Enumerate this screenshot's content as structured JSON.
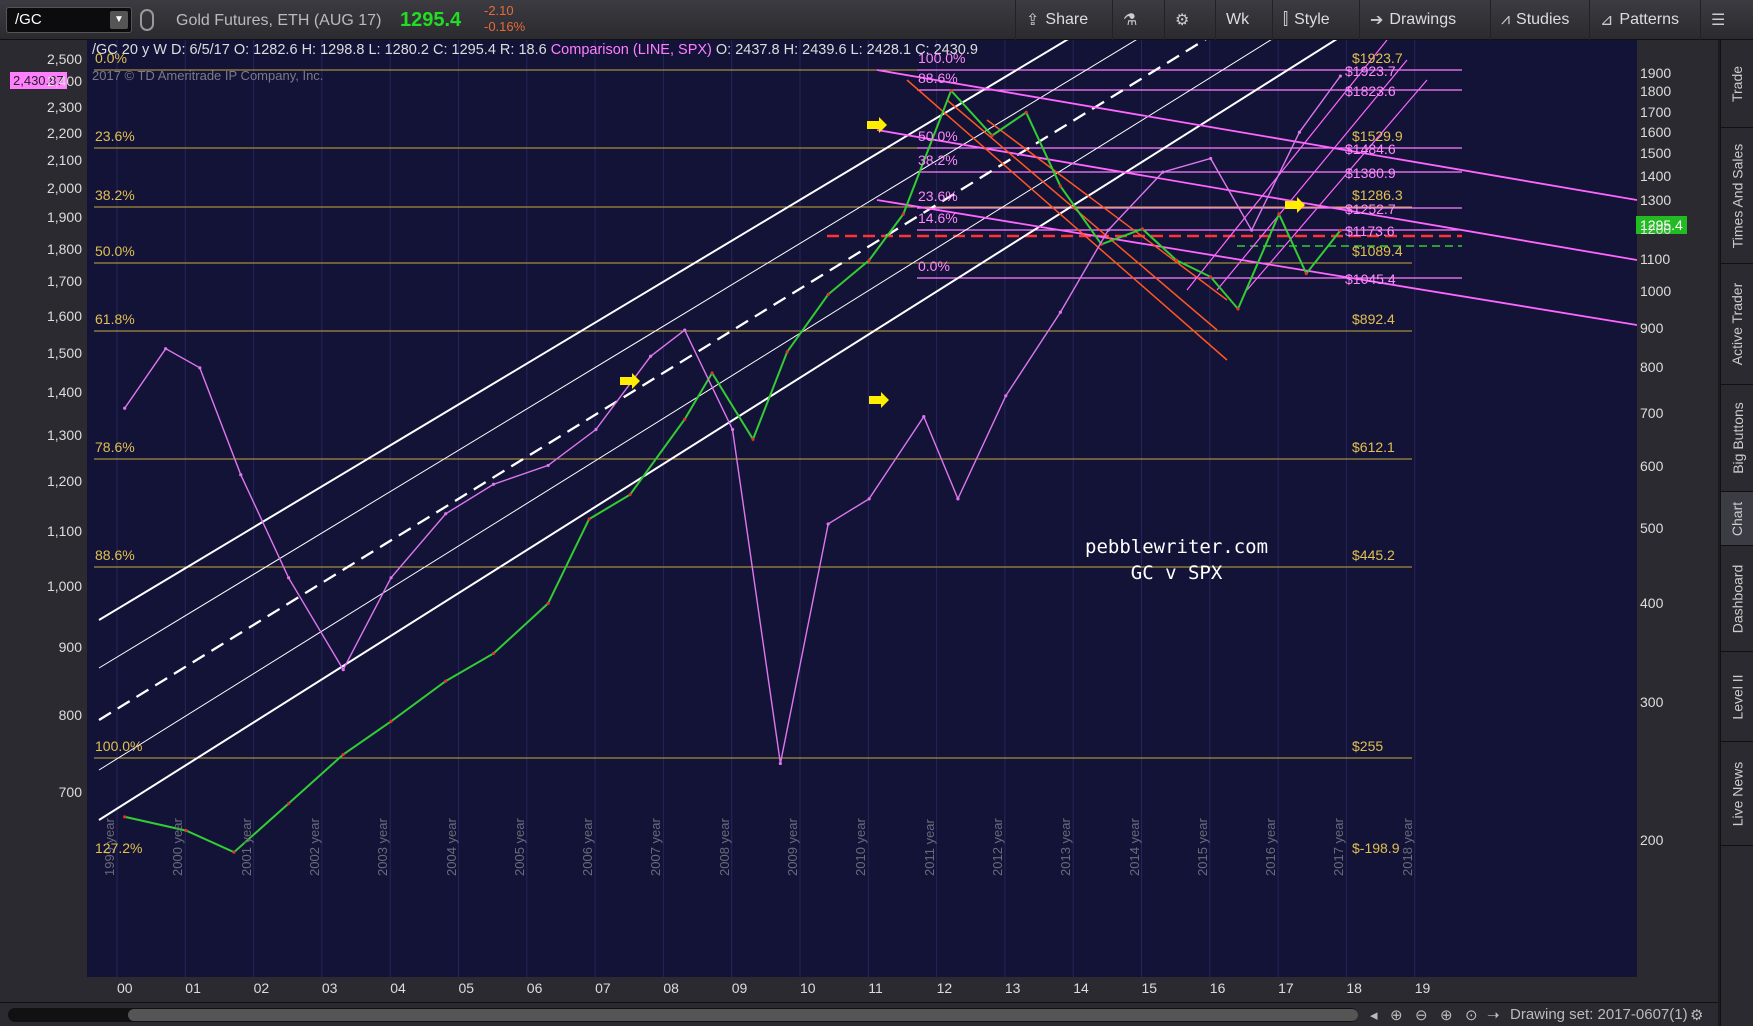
{
  "toolbar": {
    "symbol": "/GC",
    "description": "Gold Futures, ETH (AUG 17)",
    "last": "1295.4",
    "change": "-2.10",
    "change_pct": "-0.16%",
    "buttons": {
      "share": "Share",
      "wk": "Wk",
      "style": "Style",
      "drawings": "Drawings",
      "studies": "Studies",
      "patterns": "Patterns"
    }
  },
  "header": {
    "symbol_period": "/GC 20 y W",
    "d": "D: 6/5/17",
    "o": "O: 1282.6",
    "h": "H: 1298.8",
    "l": "L: 1280.2",
    "c": "C: 1295.4",
    "r": "R: 18.6",
    "comparison": "Comparison (LINE, SPX)",
    "co": "O: 2437.8",
    "ch": "H: 2439.6",
    "cl": "L: 2428.1",
    "cc": "C: 2430.9",
    "copyright": "2017 © TD Ameritrade IP Company, Inc."
  },
  "tags": {
    "spx_price": "2,430.87",
    "gc_price": "1295.4"
  },
  "left_axis": [
    "2,500",
    "2,400",
    "2,300",
    "2,200",
    "2,100",
    "2,000",
    "1,900",
    "1,800",
    "1,700",
    "1,600",
    "1,500",
    "1,400",
    "1,300",
    "1,200",
    "1,100",
    "1,000",
    "900",
    "800",
    "700"
  ],
  "right_axis": [
    "1900",
    "1800",
    "1700",
    "1600",
    "1500",
    "1400",
    "1300",
    "1200",
    "1100",
    "1000",
    "900",
    "800",
    "700",
    "600",
    "500",
    "400",
    "300",
    "200"
  ],
  "x_axis": [
    "00",
    "01",
    "02",
    "03",
    "04",
    "05",
    "06",
    "07",
    "08",
    "09",
    "10",
    "11",
    "12",
    "13",
    "14",
    "15",
    "16",
    "17",
    "18",
    "19"
  ],
  "years": [
    "1999 year",
    "2000 year",
    "2001 year",
    "2002 year",
    "2003 year",
    "2004 year",
    "2005 year",
    "2006 year",
    "2007 year",
    "2008 year",
    "2009 year",
    "2010 year",
    "2011 year",
    "2012 year",
    "2013 year",
    "2014 year",
    "2015 year",
    "2016 year",
    "2017 year",
    "2018 year"
  ],
  "fib_left": [
    "0.0%",
    "23.6%",
    "38.2%",
    "50.0%",
    "61.8%",
    "78.6%",
    "88.6%",
    "100.0%",
    "127.2%"
  ],
  "fib_right": [
    "$1923.7",
    "$1529.9",
    "$1286.3",
    "$1089.4",
    "$892.4",
    "$612.1",
    "$445.2",
    "$255",
    "$-198.9"
  ],
  "fib_pink_left": [
    "100.0%",
    "88.6%",
    "50.0%",
    "38.2%",
    "23.6%",
    "14.6%",
    "0.0%"
  ],
  "fib_pink_right": [
    "$1923.7",
    "$1823.6",
    "$1484.6",
    "$1380.9",
    "$1252.7",
    "$1173.6",
    "$1045.4"
  ],
  "watermark": {
    "line1": "pebblewriter.com",
    "line2": "GC v SPX"
  },
  "right_tabs": [
    "Trade",
    "Times And Sales",
    "Active Trader",
    "Big Buttons",
    "Chart",
    "Dashboard",
    "Level II",
    "Live News"
  ],
  "status": {
    "drawing_set": "Drawing set: 2017-0607(1)"
  },
  "colors": {
    "plot_bg": "#131338",
    "gold_fib": "#e0c050",
    "pink": "#ff7fff",
    "up": "#22cc22",
    "down": "#dd3333"
  },
  "chart_data": {
    "type": "line",
    "series": [
      {
        "name": "/GC",
        "x": [
          1999.6,
          2000.5,
          2001.2,
          2002.0,
          2002.8,
          2003.5,
          2004.3,
          2005.0,
          2005.8,
          2006.4,
          2007.0,
          2007.8,
          2008.2,
          2008.8,
          2009.3,
          2009.9,
          2010.5,
          2011.0,
          2011.7,
          2012.3,
          2012.8,
          2013.3,
          2013.9,
          2014.5,
          2015.0,
          2015.5,
          2015.9,
          2016.5,
          2016.9,
          2017.4
        ],
        "y": [
          290,
          280,
          265,
          300,
          340,
          370,
          410,
          440,
          500,
          620,
          660,
          800,
          900,
          760,
          950,
          1100,
          1200,
          1350,
          1850,
          1650,
          1750,
          1450,
          1250,
          1300,
          1200,
          1150,
          1060,
          1350,
          1160,
          1295
        ]
      },
      {
        "name": "Comparison (LINE, SPX)",
        "x": [
          1999.6,
          2000.2,
          2000.7,
          2001.3,
          2002.0,
          2002.8,
          2003.5,
          2004.3,
          2005.0,
          2005.8,
          2006.5,
          2007.3,
          2007.8,
          2008.5,
          2009.2,
          2009.9,
          2010.5,
          2011.3,
          2011.8,
          2012.5,
          2013.3,
          2014.0,
          2014.8,
          2015.5,
          2016.1,
          2016.8,
          2017.4
        ],
        "y": [
          1350,
          1500,
          1450,
          1200,
          1000,
          850,
          1000,
          1120,
          1180,
          1220,
          1300,
          1480,
          1550,
          1300,
          720,
          1100,
          1150,
          1330,
          1150,
          1380,
          1600,
          1850,
          2050,
          2100,
          1850,
          2200,
          2430
        ]
      }
    ]
  }
}
